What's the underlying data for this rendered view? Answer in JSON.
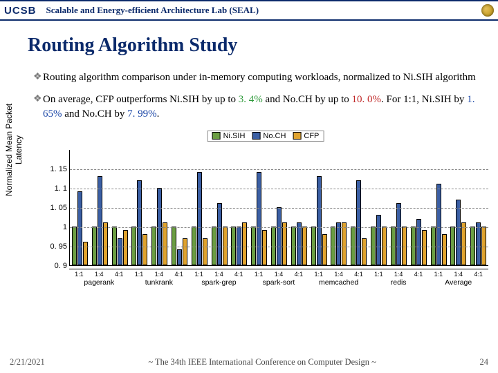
{
  "header": {
    "logo_text": "UCSB",
    "lab_title": "Scalable and Energy-efficient Architecture Lab (SEAL)"
  },
  "title": "Routing Algorithm Study",
  "bullets": {
    "b1": "Routing algorithm comparison under in-memory computing workloads, normalized to Ni.SIH algorithm",
    "b2_a": "On average, CFP outperforms Ni.SIH by up to ",
    "b2_g": "3. 4%",
    "b2_b": " and No.CH by up to ",
    "b2_r": "10. 0%",
    "b2_c": ". For 1:1, Ni.SIH by ",
    "b2_bl1": "1. 65%",
    "b2_d": " and No.CH by ",
    "b2_bl2": "7. 99%",
    "b2_e": "."
  },
  "chart_data": {
    "type": "bar",
    "ylabel": "Normalized Mean Packet\nLatency",
    "ylim": [
      0.9,
      1.2
    ],
    "yticks": [
      "0. 9",
      "0. 95",
      "1",
      "1. 05",
      "1. 1",
      "1. 15"
    ],
    "legend": [
      "Ni.SIH",
      "No.CH",
      "CFP"
    ],
    "sub_ticks": [
      "1:1",
      "1:4",
      "4:1",
      "1:1",
      "1:4",
      "4:1",
      "1:1",
      "1:4",
      "4:1",
      "1:1",
      "1:4",
      "4:1",
      "1:1",
      "1:4",
      "4:1",
      "1:1",
      "1:4",
      "4:1",
      "1:1",
      "1:4",
      "4:1"
    ],
    "major_categories": [
      "pagerank",
      "tunkrank",
      "spark-grep",
      "spark-sort",
      "memcached",
      "redis",
      "Average"
    ],
    "series": [
      {
        "name": "Ni.SIH",
        "values": [
          1.0,
          1.0,
          1.0,
          1.0,
          1.0,
          1.0,
          1.0,
          1.0,
          1.0,
          1.0,
          1.0,
          1.0,
          1.0,
          1.0,
          1.0,
          1.0,
          1.0,
          1.0,
          1.0,
          1.0,
          1.0
        ]
      },
      {
        "name": "No.CH",
        "values": [
          1.09,
          1.13,
          0.97,
          1.12,
          1.1,
          0.94,
          1.14,
          1.06,
          1.0,
          1.14,
          1.05,
          1.01,
          1.13,
          1.01,
          1.12,
          1.03,
          1.06,
          1.02,
          1.11,
          1.07,
          1.01
        ]
      },
      {
        "name": "CFP",
        "values": [
          0.96,
          1.01,
          0.99,
          0.98,
          1.01,
          0.97,
          0.97,
          1.0,
          1.01,
          0.99,
          1.01,
          1.0,
          0.98,
          1.01,
          0.97,
          1.0,
          1.0,
          0.99,
          0.98,
          1.01,
          1.0
        ]
      }
    ]
  },
  "footer": {
    "date": "2/21/2021",
    "center": "~ The 34th IEEE International Conference on Computer Design ~",
    "page": "24"
  }
}
